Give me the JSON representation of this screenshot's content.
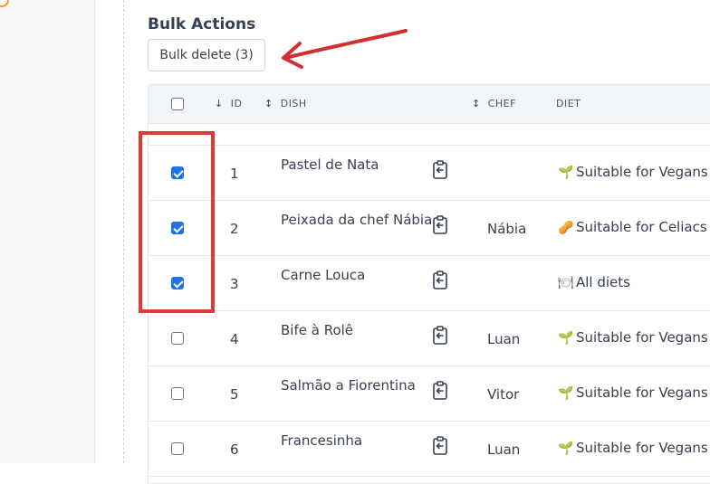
{
  "bulk_actions": {
    "title": "Bulk Actions",
    "delete_label": "Bulk delete (3)"
  },
  "table": {
    "headers": {
      "id": "ID",
      "dish": "DISH",
      "chef": "CHEF",
      "diet": "DIET"
    },
    "sort_icons": {
      "id": "↓",
      "dish": "↕",
      "chef": "↕"
    },
    "rows": [
      {
        "checked": true,
        "id": "1",
        "dish": "Pastel de Nata",
        "chef": "",
        "diet_icon": "sprout-icon",
        "diet": "Suitable for Vegans"
      },
      {
        "checked": true,
        "id": "2",
        "dish": "Peixada da chef Nábia",
        "chef": "Nábia",
        "diet_icon": "peanut-icon",
        "diet": "Suitable for Celiacs"
      },
      {
        "checked": true,
        "id": "3",
        "dish": "Carne Louca",
        "chef": "",
        "diet_icon": "plate-icon",
        "diet": "All diets"
      },
      {
        "checked": false,
        "id": "4",
        "dish": "Bife à Rolê",
        "chef": "Luan",
        "diet_icon": "sprout-icon",
        "diet": "Suitable for Vegans"
      },
      {
        "checked": false,
        "id": "5",
        "dish": "Salmão a Fiorentina",
        "chef": "Vitor",
        "diet_icon": "sprout-icon",
        "diet": "Suitable for Vegans"
      },
      {
        "checked": false,
        "id": "6",
        "dish": "Francesinha",
        "chef": "Luan",
        "diet_icon": "sprout-icon",
        "diet": "Suitable for Vegans"
      }
    ]
  },
  "colors": {
    "accent": "#1a73e8",
    "annotation": "#e53935"
  }
}
